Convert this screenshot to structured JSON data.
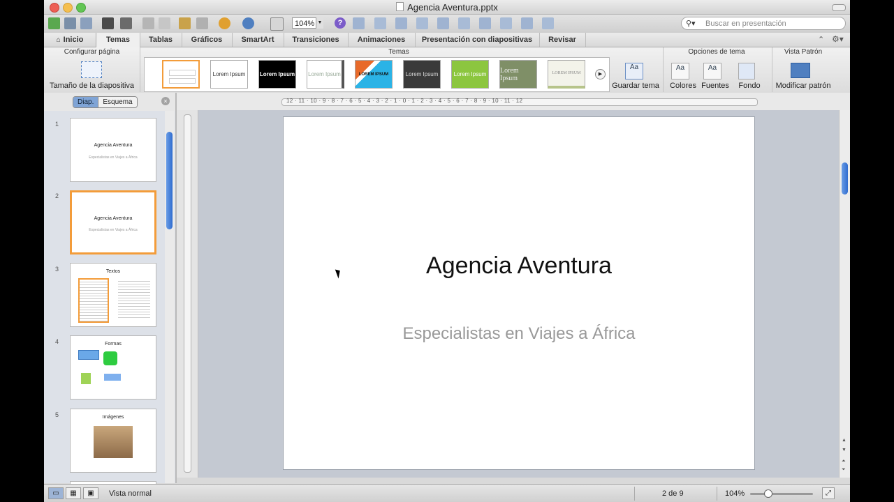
{
  "window": {
    "title": "Agencia Aventura.pptx"
  },
  "toolbar": {
    "zoom": "104%",
    "help": "?"
  },
  "search": {
    "placeholder": "Buscar en presentación"
  },
  "tabs": [
    {
      "label": "Inicio"
    },
    {
      "label": "Temas"
    },
    {
      "label": "Tablas"
    },
    {
      "label": "Gráficos"
    },
    {
      "label": "SmartArt"
    },
    {
      "label": "Transiciones"
    },
    {
      "label": "Animaciones"
    },
    {
      "label": "Presentación con diapositivas"
    },
    {
      "label": "Revisar"
    }
  ],
  "ribbon": {
    "group_config": "Configurar página",
    "slide_size": "Tamaño de la diapositiva",
    "group_themes": "Temas",
    "theme_thumbs": [
      "",
      "Lorem Ipsum",
      "Lorem Ipsum",
      "Lorem Ipsum",
      "LOREM IPSUM",
      "Lorem Ipsum",
      "Lorem Ipsum",
      "Lorem Ipsum",
      "LOREM IPSUM"
    ],
    "save_theme": "Guardar tema",
    "group_options": "Opciones de tema",
    "colors": "Colores",
    "fonts": "Fuentes",
    "background": "Fondo",
    "group_master": "Vista Patrón",
    "edit_master": "Modificar patrón"
  },
  "panel": {
    "slides_tab": "Diap.",
    "outline_tab": "Esquema"
  },
  "slides": [
    {
      "num": "1",
      "title": "Agencia Aventura",
      "sub": "Especialistas en Viajes a África"
    },
    {
      "num": "2",
      "title": "Agencia Aventura",
      "sub": "Especialistas en Viajes a África"
    },
    {
      "num": "3",
      "title": "Textos",
      "sub": ""
    },
    {
      "num": "4",
      "title": "Formas",
      "sub": ""
    },
    {
      "num": "5",
      "title": "Imágenes",
      "sub": ""
    }
  ],
  "ruler": {
    "h_labels": "12 · 11 · 10 · 9 · 8 · 7 · 6 · 5 · 4 · 3 · 2 · 1 · 0 · 1 · 2 · 3 · 4 · 5 · 6 · 7 · 8 · 9 · 10 · 11 · 12"
  },
  "main_slide": {
    "title": "Agencia Aventura",
    "subtitle": "Especialistas en Viajes a África"
  },
  "status": {
    "view": "Vista normal",
    "page": "2 de 9",
    "zoom": "104%"
  },
  "colors": {
    "accent_blue": "#2f6ccf",
    "selection_orange": "#f39c3a"
  }
}
